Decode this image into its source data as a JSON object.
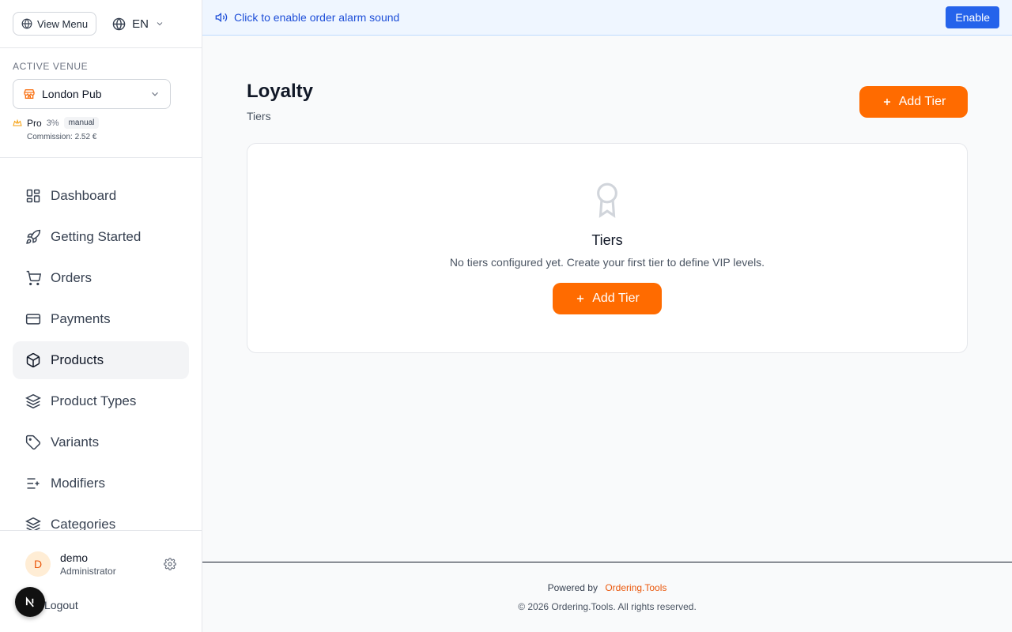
{
  "sidebar": {
    "view_menu_label": "View Menu",
    "language": "EN",
    "venue_label": "ACTIVE VENUE",
    "venue_name": "London Pub",
    "plan_name": "Pro",
    "plan_percent": "3%",
    "plan_mode": "manual",
    "commission": "Commission: 2.52 €",
    "nav": [
      {
        "label": "Dashboard",
        "icon": "dashboard-icon"
      },
      {
        "label": "Getting Started",
        "icon": "rocket-icon"
      },
      {
        "label": "Orders",
        "icon": "cart-icon"
      },
      {
        "label": "Payments",
        "icon": "credit-card-icon"
      },
      {
        "label": "Products",
        "icon": "box-icon",
        "active": true
      },
      {
        "label": "Product Types",
        "icon": "layers-icon"
      },
      {
        "label": "Variants",
        "icon": "tag-icon"
      },
      {
        "label": "Modifiers",
        "icon": "list-plus-icon"
      },
      {
        "label": "Categories",
        "icon": "layers-icon"
      }
    ],
    "user": {
      "initial": "D",
      "name": "demo",
      "role": "Administrator"
    },
    "logout_label": "Logout"
  },
  "banner": {
    "text": "Click to enable order alarm sound",
    "button_label": "Enable"
  },
  "main": {
    "title": "Loyalty",
    "subtitle": "Tiers",
    "add_tier_label": "Add Tier",
    "empty": {
      "title": "Tiers",
      "text": "No tiers configured yet. Create your first tier to define VIP levels.",
      "button_label": "Add Tier"
    }
  },
  "footer": {
    "powered_by": "Powered by",
    "brand": "Ordering.Tools",
    "copyright": "© 2026 Ordering.Tools. All rights reserved."
  },
  "colors": {
    "accent": "#ff6b00",
    "banner_bg": "#eff6ff",
    "banner_text": "#1d4ed8",
    "enable_button": "#2563eb"
  }
}
